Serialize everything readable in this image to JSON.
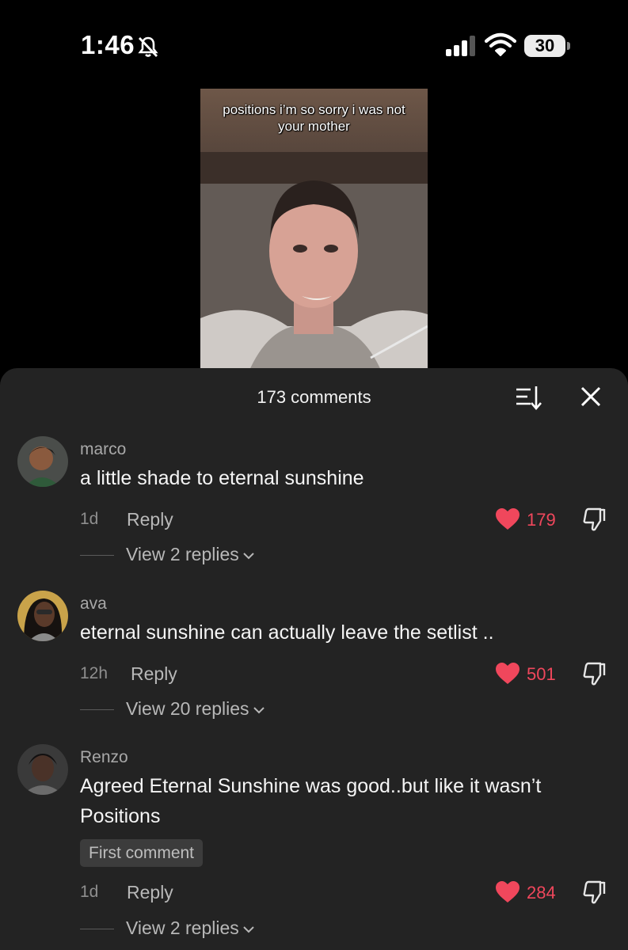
{
  "status_bar": {
    "time": "1:46",
    "battery": "30"
  },
  "video": {
    "caption": "positions i’m so sorry i was not your mother"
  },
  "sheet": {
    "title": "173 comments",
    "comments": [
      {
        "username": "marco",
        "text": "a little shade to eternal sunshine",
        "age": "1d",
        "reply_label": "Reply",
        "likes": "179",
        "view_replies": "View 2 replies"
      },
      {
        "username": "ava",
        "text": "eternal sunshine can actually leave the setlist ..",
        "age": "12h",
        "reply_label": "Reply",
        "likes": "501",
        "view_replies": "View 20 replies"
      },
      {
        "username": "Renzo",
        "text": "Agreed Eternal Sunshine was good..but like it wasn’t Positions",
        "badge": "First comment",
        "age": "1d",
        "reply_label": "Reply",
        "likes": "284",
        "view_replies": "View 2 replies"
      }
    ]
  },
  "colors": {
    "sheet_bg": "#232323",
    "like_red": "#f0475c",
    "muted": "#8e8e8e"
  },
  "icons": [
    "bell-off-icon",
    "cellular-signal-icon",
    "wifi-icon",
    "battery-icon",
    "sort-icon",
    "close-icon",
    "heart-icon",
    "dislike-icon",
    "chevron-down-icon"
  ]
}
